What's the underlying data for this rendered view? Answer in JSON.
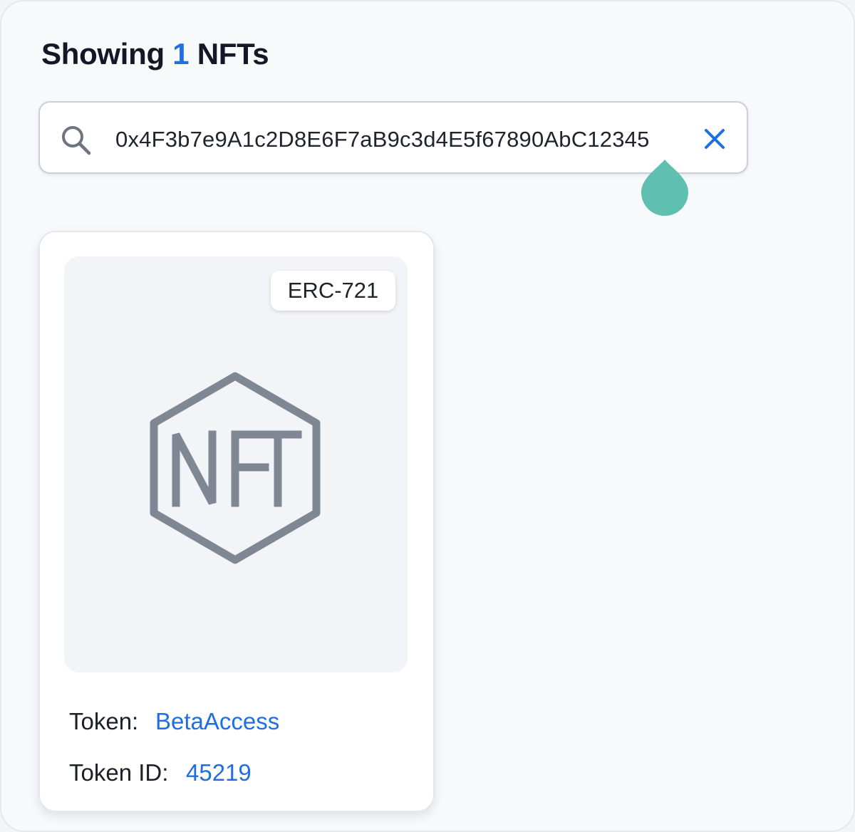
{
  "header": {
    "prefix": "Showing",
    "count": "1",
    "suffix": "NFTs"
  },
  "search": {
    "value": "0x4F3b7e9A1c2D8E6F7aB9c3d4E5f67890AbC12345",
    "icon": "search-icon",
    "clear_icon": "close-icon"
  },
  "results": [
    {
      "badge": "ERC-721",
      "image_icon": "nft-hexagon-icon",
      "token_label": "Token:",
      "token_value": "BetaAccess",
      "token_id_label": "Token ID:",
      "token_id_value": "45219"
    }
  ],
  "colors": {
    "accent": "#1f6fe0",
    "cursor": "#5fbfb0",
    "icon_gray": "#7f8794"
  }
}
